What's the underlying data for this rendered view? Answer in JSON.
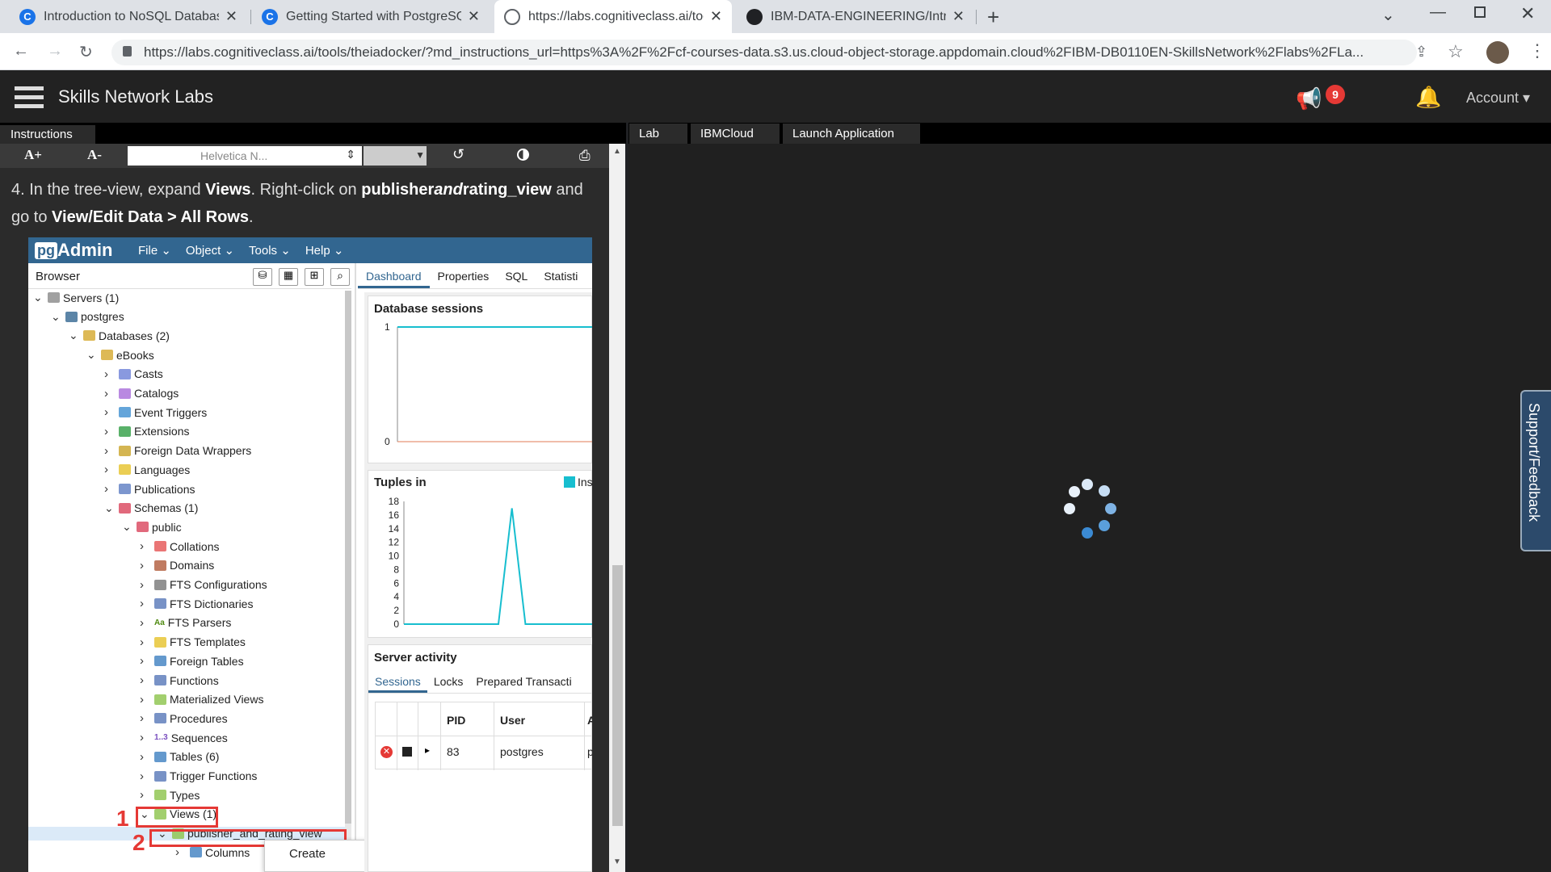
{
  "browser": {
    "tabs": [
      {
        "title": "Introduction to NoSQL Databas",
        "icon": "cognitiveclass-icon"
      },
      {
        "title": "Getting Started with PostgreSQL",
        "icon": "cognitiveclass-icon"
      },
      {
        "title": "https://labs.cognitiveclass.ai/too",
        "icon": "globe-icon"
      },
      {
        "title": "IBM-DATA-ENGINEERING/Introd",
        "icon": "github-icon"
      }
    ],
    "url": "https://labs.cognitiveclass.ai/tools/theiadocker/?md_instructions_url=https%3A%2F%2Fcf-courses-data.s3.us.cloud-object-storage.appdomain.cloud%2FIBM-DB0110EN-SkillsNetwork%2Flabs%2FLa..."
  },
  "app": {
    "title": "Skills Network Labs",
    "notification_count": "9",
    "account": "Account"
  },
  "instructions": {
    "tab": "Instructions",
    "font_up": "A+",
    "font_down": "A-",
    "font_select": "Helvetica N...",
    "step_number": "4.",
    "step_parts": [
      "In the tree-view, expand ",
      "Views",
      ". Right-click on ",
      "publisher",
      "and",
      "rating",
      "_view",
      " and go to ",
      "View/Edit Data > All Rows",
      "."
    ]
  },
  "lab": {
    "tabs": [
      "Lab",
      "IBMCloud",
      "Launch Application"
    ],
    "support": "Support/Feedback"
  },
  "pgadmin": {
    "logo_pg": "pg",
    "logo_admin": "Admin",
    "menu": [
      "File",
      "Object",
      "Tools",
      "Help"
    ],
    "browser_title": "Browser",
    "dash_tabs": [
      "Dashboard",
      "Properties",
      "SQL",
      "Statisti"
    ],
    "tree": [
      {
        "label": "Servers (1)",
        "level": 0,
        "open": true,
        "icon": "server-icon",
        "color": "#888"
      },
      {
        "label": "postgres",
        "level": 1,
        "open": true,
        "icon": "elephant-icon",
        "color": "#336791"
      },
      {
        "label": "Databases (2)",
        "level": 2,
        "open": true,
        "icon": "database-icon",
        "color": "#d4a72c"
      },
      {
        "label": "eBooks",
        "level": 3,
        "open": true,
        "icon": "database-icon",
        "color": "#d4a72c"
      },
      {
        "label": "Casts",
        "level": 4,
        "icon": "cast-icon",
        "color": "#6b7fd7"
      },
      {
        "label": "Catalogs",
        "level": 4,
        "icon": "catalog-icon",
        "color": "#a86bd9"
      },
      {
        "label": "Event Triggers",
        "level": 4,
        "icon": "event-trigger-icon",
        "color": "#3d8fd1"
      },
      {
        "label": "Extensions",
        "level": 4,
        "icon": "extension-icon",
        "color": "#2f9e44"
      },
      {
        "label": "Foreign Data Wrappers",
        "level": 4,
        "icon": "fdw-icon",
        "color": "#c9a227"
      },
      {
        "label": "Languages",
        "level": 4,
        "icon": "language-icon",
        "color": "#e6c229"
      },
      {
        "label": "Publications",
        "level": 4,
        "icon": "publication-icon",
        "color": "#5b7cc2"
      },
      {
        "label": "Schemas (1)",
        "level": 4,
        "open": true,
        "icon": "schema-icon",
        "color": "#d9435b"
      },
      {
        "label": "public",
        "level": 5,
        "open": true,
        "icon": "schema-public-icon",
        "color": "#d9435b"
      },
      {
        "label": "Collations",
        "level": 6,
        "icon": "collation-icon",
        "color": "#e55353"
      },
      {
        "label": "Domains",
        "level": 6,
        "icon": "domain-icon",
        "color": "#b05a3a"
      },
      {
        "label": "FTS Configurations",
        "level": 6,
        "icon": "fts-config-icon",
        "color": "#777"
      },
      {
        "label": "FTS Dictionaries",
        "level": 6,
        "icon": "fts-dict-icon",
        "color": "#5677b8"
      },
      {
        "label": "FTS Parsers",
        "level": 6,
        "icon": "fts-parser-icon",
        "color": "#4f8a10",
        "glyph": "Aa"
      },
      {
        "label": "FTS Templates",
        "level": 6,
        "icon": "fts-template-icon",
        "color": "#e6c229"
      },
      {
        "label": "Foreign Tables",
        "level": 6,
        "icon": "foreign-table-icon",
        "color": "#3d7fc1"
      },
      {
        "label": "Functions",
        "level": 6,
        "icon": "function-icon",
        "color": "#5677b8"
      },
      {
        "label": "Materialized Views",
        "level": 6,
        "icon": "mview-icon",
        "color": "#8bc34a"
      },
      {
        "label": "Procedures",
        "level": 6,
        "icon": "procedure-icon",
        "color": "#5677b8"
      },
      {
        "label": "Sequences",
        "level": 6,
        "icon": "sequence-icon",
        "color": "#7a4fbf",
        "glyph": "1..3"
      },
      {
        "label": "Tables (6)",
        "level": 6,
        "icon": "table-icon",
        "color": "#3d7fc1"
      },
      {
        "label": "Trigger Functions",
        "level": 6,
        "icon": "trigger-function-icon",
        "color": "#5677b8"
      },
      {
        "label": "Types",
        "level": 6,
        "icon": "type-icon",
        "color": "#8bc34a"
      },
      {
        "label": "Views (1)",
        "level": 6,
        "open": true,
        "icon": "view-icon",
        "color": "#8bc34a"
      },
      {
        "label": "publisher_and_rating_view",
        "level": 7,
        "open": true,
        "icon": "view-icon",
        "color": "#8bc34a"
      },
      {
        "label": "Columns",
        "level": 8,
        "icon": "columns-icon",
        "color": "#3d7fc1"
      }
    ],
    "markers": [
      "1",
      "2"
    ],
    "context_menu": {
      "item": "Create",
      "arrow": "›"
    },
    "db_sessions": {
      "title": "Database sessions",
      "yticks": [
        "1",
        "0"
      ]
    },
    "tuples_in": {
      "title": "Tuples in",
      "legend": "Ins",
      "yticks": [
        "18",
        "16",
        "14",
        "12",
        "10",
        "8",
        "6",
        "4",
        "2",
        "0"
      ]
    },
    "server_activity": {
      "title": "Server activity",
      "tabs": [
        "Sessions",
        "Locks",
        "Prepared Transacti"
      ],
      "headers": [
        "PID",
        "User",
        "A"
      ],
      "row": [
        "83",
        "postgres",
        "p"
      ]
    }
  },
  "chart_data": [
    {
      "type": "line",
      "title": "Database sessions",
      "ylim": [
        0,
        1
      ],
      "series": [
        {
          "values": [
            1,
            1,
            1,
            1,
            1,
            1,
            1,
            1,
            1,
            1
          ]
        }
      ]
    },
    {
      "type": "line",
      "title": "Tuples in",
      "ylim": [
        0,
        18
      ],
      "series": [
        {
          "name": "Ins",
          "values": [
            0,
            0,
            0,
            0,
            0,
            0,
            0,
            0,
            17,
            0,
            0,
            0,
            0,
            0,
            0
          ]
        }
      ]
    }
  ]
}
